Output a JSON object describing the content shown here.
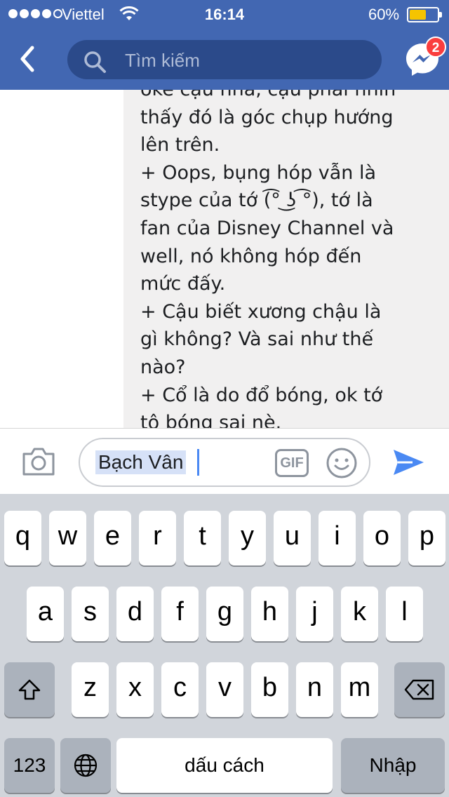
{
  "status_bar": {
    "carrier": "Viettel",
    "time": "16:14",
    "battery_percent": "60%",
    "battery_level": 0.6,
    "battery_color": "#f5c400"
  },
  "nav": {
    "back_icon": "chevron-left-icon",
    "search_placeholder": "Tìm kiếm",
    "messenger_icon": "messenger-icon",
    "badge_count": "2",
    "bar_color": "#4267b2"
  },
  "message": {
    "text": "oke cậu nha, cậu phải nhìn\nthấy đó là góc chụp hướng\nlên trên.\n+ Oops, bụng hóp vẫn là\nstype của tớ (͡° ͜ʖ ͡°), tớ là\nfan của Disney Channel và\nwell, nó không hóp đến\nmức đấy.\n+ Cậu biết xương chậu là\ngì không? Và sai như thế\nnào?\n+ Cổ là do đổ bóng, ok tớ\ntô bóng sai nè."
  },
  "composer": {
    "camera_icon": "camera-icon",
    "input_value": "Bạch Vân",
    "gif_label": "GIF",
    "emoji_icon": "smiley-icon",
    "send_icon": "send-icon",
    "accent": "#4a89f3"
  },
  "keyboard": {
    "row1": [
      "q",
      "w",
      "e",
      "r",
      "t",
      "y",
      "u",
      "i",
      "o",
      "p"
    ],
    "row2": [
      "a",
      "s",
      "d",
      "f",
      "g",
      "h",
      "j",
      "k",
      "l"
    ],
    "row3": [
      "z",
      "x",
      "c",
      "v",
      "b",
      "n",
      "m"
    ],
    "numbers_key": "123",
    "space_key": "dấu cách",
    "return_key": "Nhập",
    "shift_icon": "shift-icon",
    "delete_icon": "backspace-icon",
    "globe_icon": "globe-icon"
  }
}
